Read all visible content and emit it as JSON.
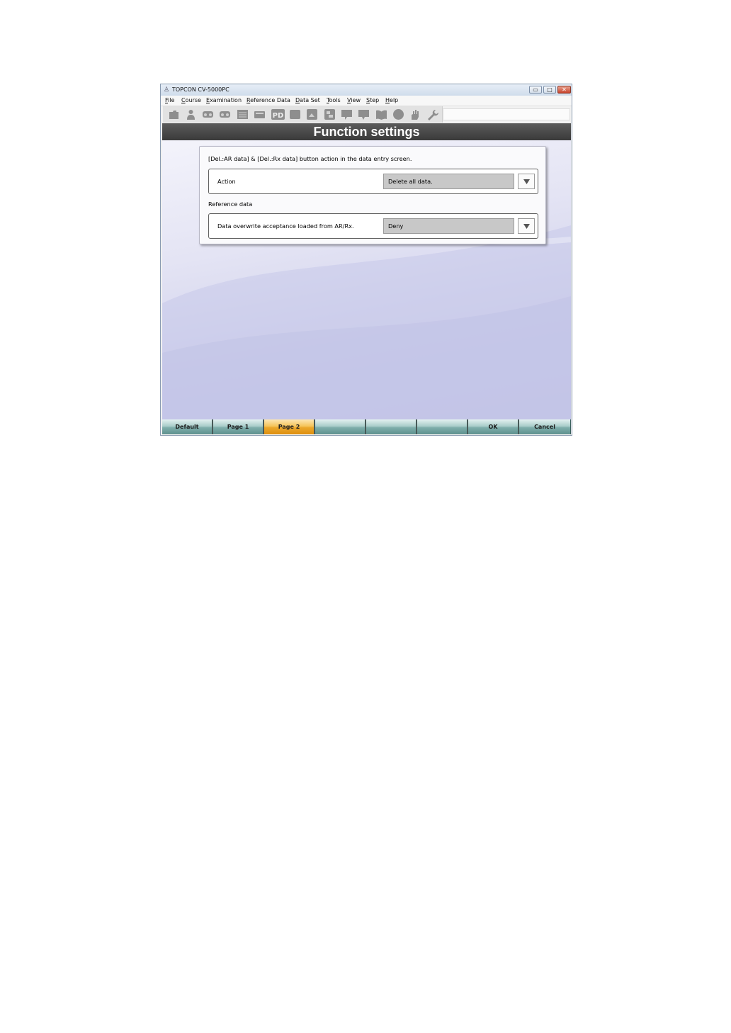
{
  "window": {
    "title": "TOPCON CV-5000PC",
    "app_icon": "person-icon",
    "controls": {
      "minimize": "▭",
      "maximize": "□",
      "close": "✕"
    }
  },
  "menubar": {
    "items": [
      "File",
      "Course",
      "Examination",
      "Reference Data",
      "Data Set",
      "Tools",
      "View",
      "Step",
      "Help"
    ]
  },
  "toolbar": {
    "icons": [
      "folder-icon",
      "person-icon",
      "eyeglasses-icon",
      "eyeglasses-icon",
      "chart-icon",
      "card-icon",
      "pd-icon",
      "square-icon",
      "lens-icon",
      "lens-settings-icon",
      "speech-bubble-icon",
      "speech-bubble-icon",
      "book-icon",
      "circle-icon",
      "hand-icon",
      "wrench-icon"
    ],
    "pd_label": "PD"
  },
  "header": {
    "title": "Function settings"
  },
  "panel": {
    "section1": {
      "heading": "[Del.:AR data] & [Del.:Rx data] button action in the data entry screen.",
      "label": "Action",
      "value": "Delete all data."
    },
    "section2": {
      "heading": "Reference data",
      "label": "Data overwrite acceptance loaded from AR/Rx.",
      "value": "Deny"
    }
  },
  "bottombar": {
    "buttons": [
      {
        "label": "Default",
        "active": false
      },
      {
        "label": "Page 1",
        "active": false
      },
      {
        "label": "Page 2",
        "active": true
      },
      {
        "label": "",
        "active": false
      },
      {
        "label": "",
        "active": false
      },
      {
        "label": "",
        "active": false
      },
      {
        "label": "OK",
        "active": false
      },
      {
        "label": "Cancel",
        "active": false
      }
    ]
  },
  "colors": {
    "header_bg": "#444444",
    "active_button": "#f5c45b",
    "button": "#8fbcb9",
    "content_bg": "#d6d7ef"
  }
}
